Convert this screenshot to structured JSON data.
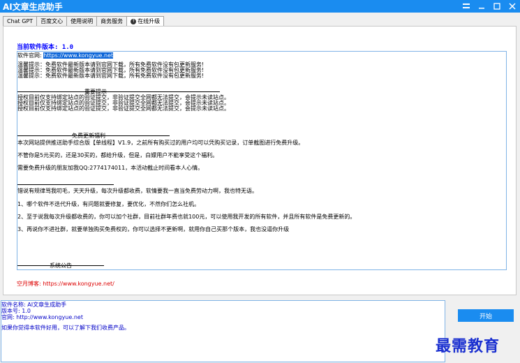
{
  "window": {
    "title": "AI文章生成助手",
    "controls": [
      "minimize-icon",
      "menu-icon",
      "maximize-icon",
      "close-icon"
    ]
  },
  "tabs": [
    {
      "label": "Chat GPT",
      "active": false
    },
    {
      "label": "百度文心",
      "active": false
    },
    {
      "label": "使用说明",
      "active": false
    },
    {
      "label": "商务服务",
      "active": false
    },
    {
      "label": "在线升级",
      "active": true,
      "icon": "upgrade-icon"
    }
  ],
  "upgrade": {
    "version_label": "当前软件版本: 1.0",
    "site_label": "软件官网:",
    "site_url": "https://www.kongyue.net",
    "warnings": [
      "温馨提示：免费软件最新版本请到官网下载，所有免费软件没有包更新服务!",
      "温馨提示：免费软件最新版本请到官网下载，所有免费软件没有包更新服务!",
      "温馨提示：免费软件最新版本请到官网下载，所有免费软件没有包更新服务!"
    ],
    "important_title": "重要提示",
    "important_lines": [
      "授权目前仅支持绑定站点的验证提交，非验证提交全网都无法提交，会提示未读站点。",
      "授权目前仅支持绑定站点的验证提交，非验证提交全网都无法提交，会提示未读站点。",
      "授权目前仅支持绑定站点的验证提交，非验证提交全网都无法提交，会提示未读站点。"
    ],
    "benefit_title": "免费更新福利",
    "benefit_lines": [
      "本次网站提供推送助手综合版【单线程】V1.9，之前所有购买过的用户均可以凭购买记录，订单截图进行免费升级。",
      "不管你是5元买的，还是30买的，都给升级，但是，白嫖用户不能享受这个福利。",
      "需要免费升级的朋友加我QQ:2774174011，本活动截止时间看本人心情。"
    ],
    "talk_lines": [
      "错说有规律骂我叨毛，天天升级，每次升级都收费，软情要我一直当免费劳动力啊，我也特无语。",
      "1、哪个软件不迭代升级，有问题就要修复，要优化，不然你们怎么社机。",
      "2、至于说我每次升级都收费的，你可以加个社群，目前社群年费也就100元，可以使用我开发的所有软件，并且所有软件是免费更新的。",
      "3、再说你不进社群，就要单独购买免费权的，你可以选择不更新啊，就用你自己买那个版本，我也没逼你升级"
    ],
    "system_title": "系统公告",
    "blog": "空月博客: https://www.kongyue.net/"
  },
  "output": {
    "lines": [
      "软件名称: AI文章生成助手",
      "版本号: 1.0",
      "官网: http://www.kongyue.net",
      "",
      "如果你觉得本软件好用，可以了解下我们收费产品。"
    ]
  },
  "start_label": "开始",
  "watermark": "最需教育",
  "colors": {
    "accent": "#1a8cf0",
    "link_blue": "#0000ff",
    "blog_red": "#dd0000",
    "output_blue": "#0000c8"
  }
}
